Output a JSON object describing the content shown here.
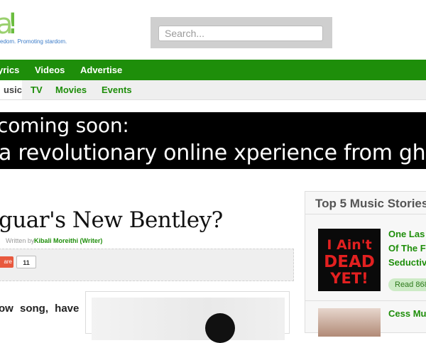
{
  "header": {
    "logo_letter": "a",
    "logo_bang": "!",
    "tagline": "edom. Promoting stardom."
  },
  "search": {
    "placeholder": "Search..."
  },
  "nav": {
    "main": [
      "yrics",
      "Videos",
      "Advertise"
    ],
    "sub": [
      "usic",
      "TV",
      "Movies",
      "Events"
    ]
  },
  "banner": {
    "line1": "coming soon:",
    "line2": "a revolutionary online xperience from ghafla!"
  },
  "article": {
    "title": "guar's New Bentley?",
    "written_by": "Written by",
    "author": "Kibali Moreithi (Writer)",
    "share_label": "are",
    "share_count": "11",
    "body_text": "ow song, have"
  },
  "sidebar": {
    "title": "Top 5 Music Stories",
    "story1": {
      "image_text": [
        "I Ain't",
        "DEAD",
        "YET!"
      ],
      "title_lines": [
        "One Las",
        "Of The F",
        "Seductiv"
      ],
      "read_button": "Read 868"
    },
    "story2": {
      "title": "Cess Mu"
    }
  },
  "colors": {
    "nav_green": "#1e8e0a",
    "link_green": "#1e8e0a",
    "banner_bg": "#000000",
    "share_orange": "#e8593e"
  }
}
